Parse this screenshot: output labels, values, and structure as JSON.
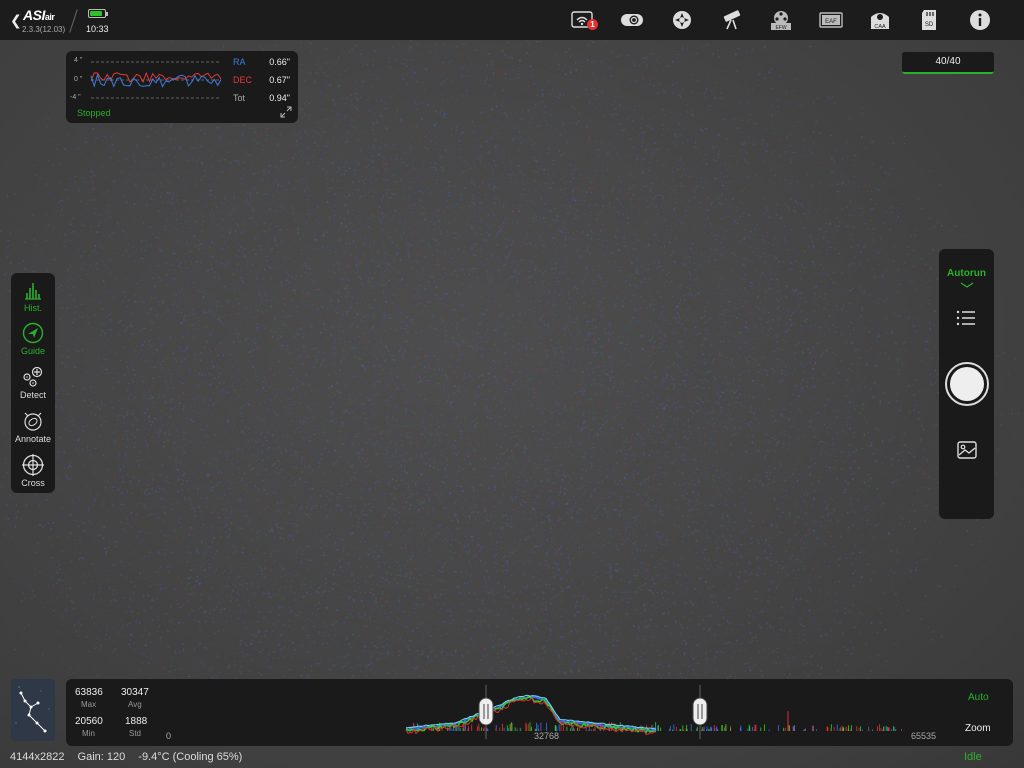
{
  "app": {
    "logo_main": "ASI",
    "logo_small": "air",
    "version": "2.3.3(12.03)",
    "clock": "10:33",
    "battery_fraction": 0.85,
    "wifi_badge": "1"
  },
  "top_icons": [
    "wifi-icon",
    "camera-icon",
    "mount-icon",
    "telescope-icon",
    "filter-wheel-icon",
    "focuser-icon",
    "caa-icon",
    "sd-card-icon",
    "info-icon"
  ],
  "top_icon_labels": {
    "filter_wheel": "EFW",
    "focuser": "EAF",
    "caa": "CAA",
    "sd": "SD"
  },
  "guide_panel": {
    "y_top": "4 \"",
    "y_mid": "0 \"",
    "y_bottom": "-4 \"",
    "ra_label": "RA",
    "ra_value": "0.66\"",
    "dec_label": "DEC",
    "dec_value": "0.67\"",
    "tot_label": "Tot",
    "tot_value": "0.94\"",
    "status": "Stopped",
    "colors": {
      "ra": "#3b7ee0",
      "dec": "#e03a3a"
    }
  },
  "frame_counter": "40/40",
  "left_tools": [
    {
      "label": "Hist.",
      "active": true
    },
    {
      "label": "Guide",
      "active": true
    },
    {
      "label": "Detect",
      "active": false
    },
    {
      "label": "Annotate",
      "active": false
    },
    {
      "label": "Cross",
      "active": false
    }
  ],
  "right_panel": {
    "autorun": "Autorun"
  },
  "histogram": {
    "max_value": "63836",
    "max_label": "Max",
    "avg_value": "30347",
    "avg_label": "Avg",
    "min_value": "20560",
    "min_label": "Min",
    "std_value": "1888",
    "std_label": "Std",
    "axis_min": "0",
    "axis_mid": "32768",
    "axis_max": "65535",
    "auto": "Auto",
    "zoom": "Zoom"
  },
  "status_bar": {
    "resolution": "4144x2822",
    "gain": "Gain: 120",
    "temperature": "-9.4°C (Cooling 65%)",
    "state": "Idle"
  },
  "accent_color": "#2bb02b"
}
